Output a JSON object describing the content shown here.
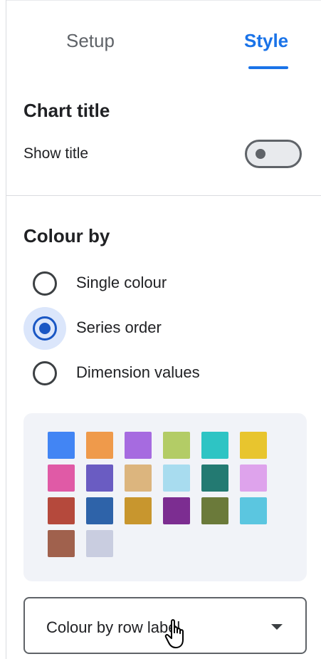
{
  "tabs": {
    "setup": "Setup",
    "style": "Style",
    "active": "Style"
  },
  "chart_title": {
    "header": "Chart title",
    "show_title_label": "Show title",
    "show_title_on": false
  },
  "colour_by": {
    "header": "Colour by",
    "options": [
      "Single colour",
      "Series order",
      "Dimension values"
    ],
    "selected": "Series order"
  },
  "palette": {
    "colors": [
      "#4285f4",
      "#ef9a4b",
      "#a66be0",
      "#b3cc66",
      "#2ec4c4",
      "#e8c52e",
      "#e05aa6",
      "#6a5cc2",
      "#dcb57e",
      "#a8dcef",
      "#237a72",
      "#dea3ec",
      "#b5493c",
      "#2e63a9",
      "#c8962e",
      "#7c2d91",
      "#6b7a3a",
      "#5bc6e0",
      "#a0614d",
      "#c9cde0"
    ]
  },
  "colour_dropdown": {
    "value": "Colour by row label"
  },
  "icons": {
    "cursor": "hand-pointer-icon",
    "dropdown": "caret-down-icon"
  },
  "accent_color": "#1a73e8"
}
